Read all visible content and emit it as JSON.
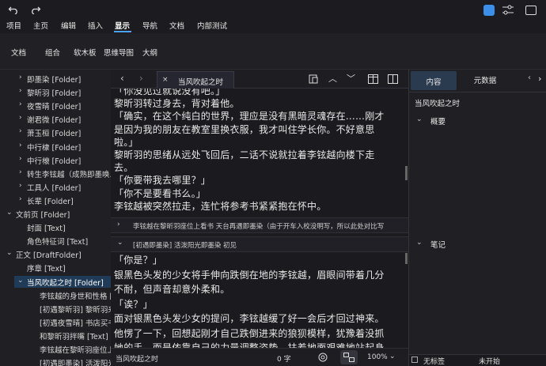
{
  "toolbar": {
    "undo_icon": "undo-icon",
    "redo_icon": "redo-icon"
  },
  "menu": {
    "items": [
      "项目",
      "主页",
      "编辑",
      "插入",
      "显示",
      "导航",
      "文档",
      "内部测试"
    ],
    "active": "显示"
  },
  "ribbon": {
    "items": [
      "文档",
      "组合",
      "软木板",
      "思维导图",
      "大纲"
    ]
  },
  "binder": {
    "rows": [
      {
        "label": "即墨染 [Folder]",
        "chevron": ">"
      },
      {
        "label": "黎昕羽 [Folder]",
        "chevron": ">"
      },
      {
        "label": "夜雪晴 [Folder]",
        "chevron": ">"
      },
      {
        "label": "谢君微 [Folder]",
        "chevron": ">"
      },
      {
        "label": "萧玉桓 [Folder]",
        "chevron": ">"
      },
      {
        "label": "中行棣 [Folder]",
        "chevron": ">"
      },
      {
        "label": "中行榱 [Folder]",
        "chevron": ">"
      },
      {
        "label": "转生李铉越（成熟即墨唤...",
        "chevron": ">"
      },
      {
        "label": "工具人 [Folder]",
        "chevron": ">"
      },
      {
        "label": "长辈 [Folder]",
        "chevron": ">"
      },
      {
        "label": "文前页 [Folder]",
        "chevron": "v"
      },
      {
        "label": "封面 [Text]",
        "chevron": ""
      },
      {
        "label": "角色特征词 [Text]",
        "chevron": ""
      },
      {
        "label": "正文 [DraftFolder]",
        "chevron": "v"
      },
      {
        "label": "序章 [Text]",
        "chevron": ""
      },
      {
        "label": "当风吹起之时 [Folder]",
        "chevron": "v"
      },
      {
        "label": "李铉越的身世和性格 [",
        "chevron": ""
      },
      {
        "label": "[初遇黎昕羽] 黎昕羽来",
        "chevron": ""
      },
      {
        "label": "[初遇夜雪晴] 书店买书",
        "chevron": ""
      },
      {
        "label": "和黎昕羽拌嘴 [Text]",
        "chevron": ""
      },
      {
        "label": "李铉越在黎昕羽座位上",
        "chevron": ""
      },
      {
        "label": "[初遇即墨染] 活泼阳光",
        "chevron": ""
      }
    ]
  },
  "editor": {
    "tab_title": "当风吹起之时",
    "top_lines": [
      "「你没见过就说没有吧。」",
      "黎昕羽转过身去，背对着他。",
      "「确实，在这个纯白的世界，理应是没有黑暗灵魂存在……刚才",
      "是因为我的朋友在教室里换衣服，我才叫住学长你。不好意思",
      "啦。」",
      "黎昕羽的思绪从远处飞回后，二话不说就拉着李铉越向楼下走",
      "去。",
      "「你要带我去哪里？」",
      "「你不是要看书么。」",
      "李铉越被突然拉走，连忙将参考书紧紧抱在怀中。"
    ],
    "section1_title": "李铉越在黎昕羽座位上看书 天台再遇即墨染（由于开车入校没明写，所以此处对比写",
    "section2_title": "[初遇即墨染] 活泼阳光即墨染 初见",
    "bottom_lines": [
      "「你是？」",
      "银黑色头发的少女将手伸向跌倒在地的李铉越，眉眼间带着几分",
      "不耐，但声音却意外柔和。",
      "「诶？」",
      "面对银黑色头发少女的提问，李铉越缓了好一会后才回过神来。",
      "他愣了一下，回想起刚才自己跌倒进来的狼狈模样，犹豫着没抓",
      "她的手，而是依靠自己的力量调整姿势，扶着地面艰难地站起身"
    ]
  },
  "status": {
    "doc_title": "当风吹起之时",
    "word_count": "0 字",
    "zoom": "100%"
  },
  "inspector": {
    "tab_content": "内容",
    "tab_metadata": "元数据",
    "doc_title": "当风吹起之时",
    "synopsis_label": "概要",
    "notes_label": "笔记",
    "label_value": "无标签",
    "status_value": "未开始"
  },
  "colors": {
    "accent": "#4aa3ff",
    "selection": "#1f3b57",
    "background": "#1b1b1f"
  }
}
